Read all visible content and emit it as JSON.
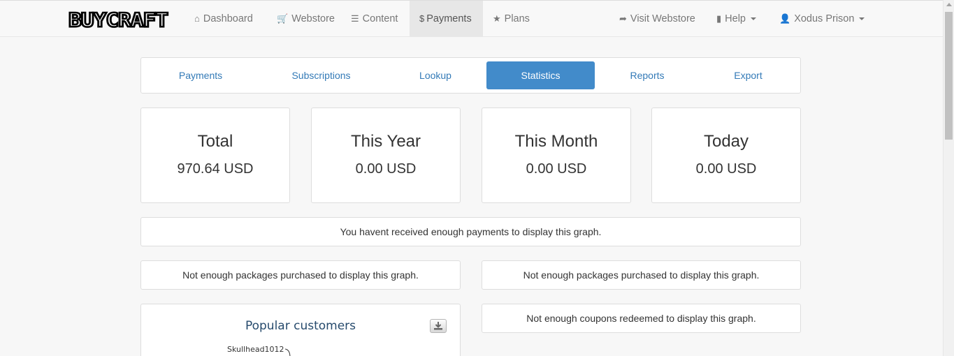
{
  "brand": {
    "logo_text": "BUYCRAFT"
  },
  "navbar": {
    "items": [
      {
        "label": "Dashboard",
        "icon": "home-icon"
      },
      {
        "label": "Webstore",
        "icon": "cart-icon"
      },
      {
        "label": "Content",
        "icon": "list-icon"
      },
      {
        "label": "Payments",
        "icon": "dollar-icon",
        "active": true
      },
      {
        "label": "Plans",
        "icon": "star-icon"
      }
    ],
    "right": {
      "visit": "Visit Webstore",
      "help": "Help",
      "user": "Xodus Prison"
    }
  },
  "tabs": [
    {
      "label": "Payments"
    },
    {
      "label": "Subscriptions"
    },
    {
      "label": "Lookup"
    },
    {
      "label": "Statistics",
      "active": true
    },
    {
      "label": "Reports"
    },
    {
      "label": "Export"
    }
  ],
  "stats": [
    {
      "title": "Total",
      "value": "970.64 USD"
    },
    {
      "title": "This Year",
      "value": "0.00 USD"
    },
    {
      "title": "This Month",
      "value": "0.00 USD"
    },
    {
      "title": "Today",
      "value": "0.00 USD"
    }
  ],
  "messages": {
    "payments_graph": "You havent received enough payments to display this graph.",
    "packages_graph_left": "Not enough packages purchased to display this graph.",
    "packages_graph_right": "Not enough packages purchased to display this graph.",
    "coupons_graph": "Not enough coupons redeemed to display this graph."
  },
  "popular_customers": {
    "title": "Popular customers",
    "customers": [
      "Skullhead1012"
    ]
  },
  "colors": {
    "accent": "#428bca",
    "link": "#337ab7",
    "navbar_bg": "#f8f8f8",
    "page_bg": "#f7f7f7"
  }
}
